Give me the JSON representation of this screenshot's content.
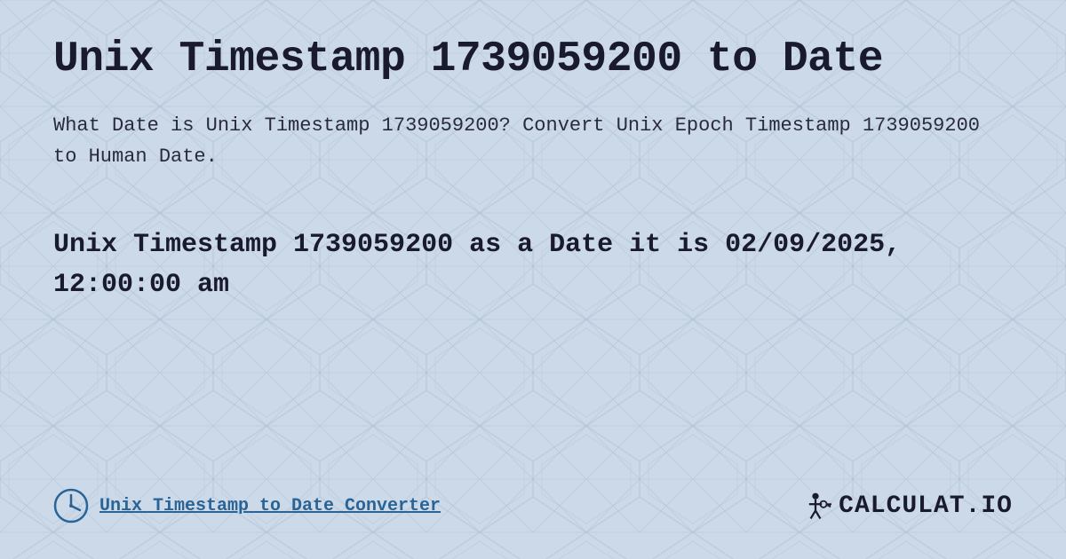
{
  "page": {
    "title": "Unix Timestamp 1739059200 to Date",
    "description": "What Date is Unix Timestamp 1739059200? Convert Unix Epoch Timestamp 1739059200 to Human Date.",
    "result": "Unix Timestamp 1739059200 as a Date it is 02/09/2025, 12:00:00 am",
    "background_color": "#c8d8e8"
  },
  "footer": {
    "link_text": "Unix Timestamp to Date Converter",
    "logo_text": "CALCULAT.IO",
    "clock_icon": "clock-icon",
    "logo_icon": "key-icon"
  }
}
